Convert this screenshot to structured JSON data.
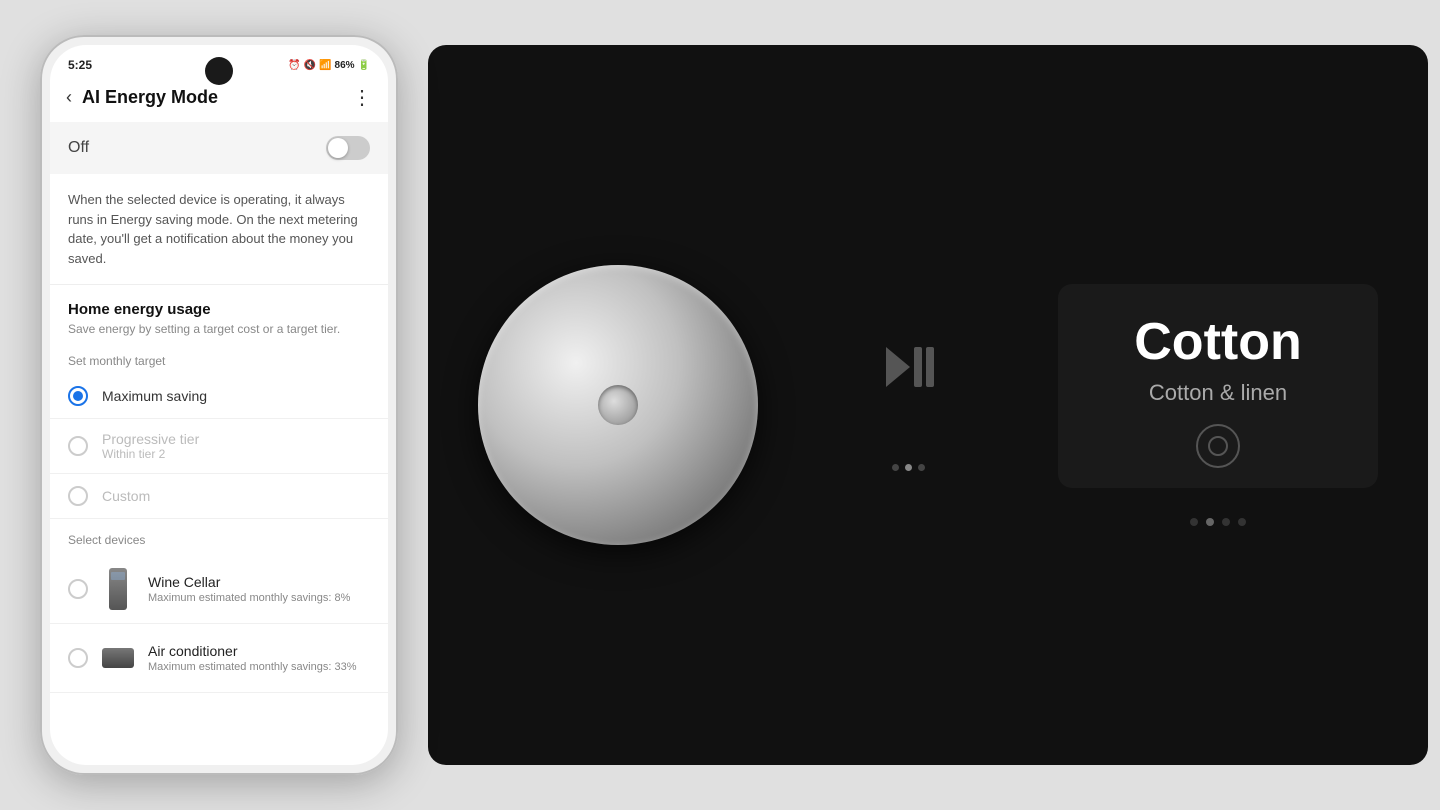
{
  "phone": {
    "status": {
      "time": "5:25",
      "icons": "⏰ 🔇 📶 86%"
    },
    "app_bar": {
      "back_icon": "‹",
      "title": "AI Energy Mode",
      "more_icon": "⋮"
    },
    "toggle": {
      "label": "Off",
      "state": "off"
    },
    "description": "When the selected device is operating, it always runs in Energy saving mode. On the next metering date, you'll get a notification about the money you saved.",
    "home_energy": {
      "title": "Home energy usage",
      "subtitle": "Save energy by setting a target cost or a target tier.",
      "sub_label": "Set monthly target",
      "options": [
        {
          "id": "max",
          "label": "Maximum saving",
          "sub": "",
          "selected": true,
          "disabled": false
        },
        {
          "id": "prog",
          "label": "Progressive tier",
          "sub": "Within tier 2",
          "selected": false,
          "disabled": true
        },
        {
          "id": "custom",
          "label": "Custom",
          "sub": "",
          "selected": false,
          "disabled": true
        }
      ]
    },
    "devices": {
      "label": "Select devices",
      "items": [
        {
          "name": "Wine Cellar",
          "savings": "Maximum estimated monthly savings: 8%",
          "icon_type": "wine"
        },
        {
          "name": "Air conditioner",
          "savings": "Maximum estimated monthly savings: 33%",
          "icon_type": "ac"
        }
      ]
    }
  },
  "washer_panel": {
    "cycle_name": "Cotton",
    "cycle_sub": "Cotton & linen",
    "play_pause_icon": "⏵❙❙",
    "dots": [
      {
        "active": false
      },
      {
        "active": true
      },
      {
        "active": false
      }
    ],
    "bottom_dots": [
      {
        "active": false
      },
      {
        "active": true
      },
      {
        "active": false
      },
      {
        "active": false
      }
    ],
    "colors": {
      "bg": "#111111",
      "knob_base": "#c0c0c0",
      "info_card_bg": "#1a1a1a",
      "text_primary": "#ffffff",
      "text_secondary": "#aaaaaa"
    }
  }
}
